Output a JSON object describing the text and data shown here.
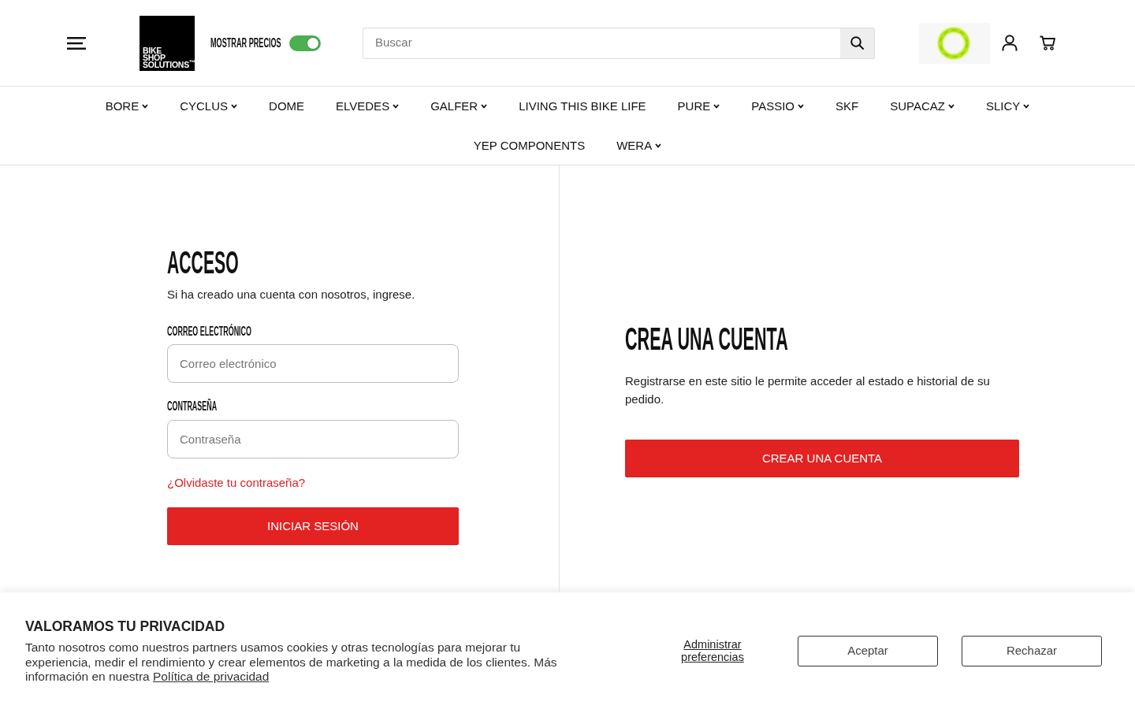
{
  "header": {
    "logo": {
      "lines": [
        "BIKE",
        "SHOP",
        "SOLUTIONS$^{™}$"
      ]
    },
    "price_toggle": {
      "label": "MOSTRAR PRECIOS",
      "on": true
    },
    "search": {
      "placeholder": "Buscar"
    }
  },
  "nav": [
    {
      "label": "BORE",
      "has_submenu": true
    },
    {
      "label": "CYCLUS",
      "has_submenu": true
    },
    {
      "label": "DOME",
      "has_submenu": false
    },
    {
      "label": "ELVEDES",
      "has_submenu": true
    },
    {
      "label": "GALFER",
      "has_submenu": true
    },
    {
      "label": "LIVING THIS BIKE LIFE",
      "has_submenu": false
    },
    {
      "label": "PURE",
      "has_submenu": true
    },
    {
      "label": "PASSIO",
      "has_submenu": true
    },
    {
      "label": "SKF",
      "has_submenu": false
    },
    {
      "label": "SUPACAZ",
      "has_submenu": true
    },
    {
      "label": "SLICY",
      "has_submenu": true
    },
    {
      "label": "YEP COMPONENTS",
      "has_submenu": false
    },
    {
      "label": "WERA",
      "has_submenu": true
    }
  ],
  "login": {
    "title": "ACCESO",
    "intro": "Si ha creado una cuenta con nosotros, ingrese.",
    "fields": [
      {
        "label": "CORREO ELECTRÓNICO",
        "placeholder": "Correo electrónico"
      },
      {
        "label": "CONTRASEÑA",
        "placeholder": "Contraseña"
      }
    ],
    "forgot_link": "¿Olvidaste tu contraseña?",
    "submit": "INICIAR SESIÓN"
  },
  "register": {
    "title": "CREA UNA CUENTA",
    "text": "Registrarse en este sitio le permite acceder al estado e historial de su pedido.",
    "button": "CREAR UNA CUENTA"
  },
  "cookie_banner": {
    "title": "VALORAMOS TU PRIVACIDAD",
    "text": "Tanto nosotros como nuestros partners usamos cookies y otras tecnologías para mejorar tu experiencia, medir el rendimiento y crear elementos de marketing a la medida de los clientes. Más información en nuestra",
    "link": "Política de privacidad",
    "manage_link": "Administrar preferencias",
    "buttons": [
      "Aceptar",
      "Rechazar"
    ]
  }
}
